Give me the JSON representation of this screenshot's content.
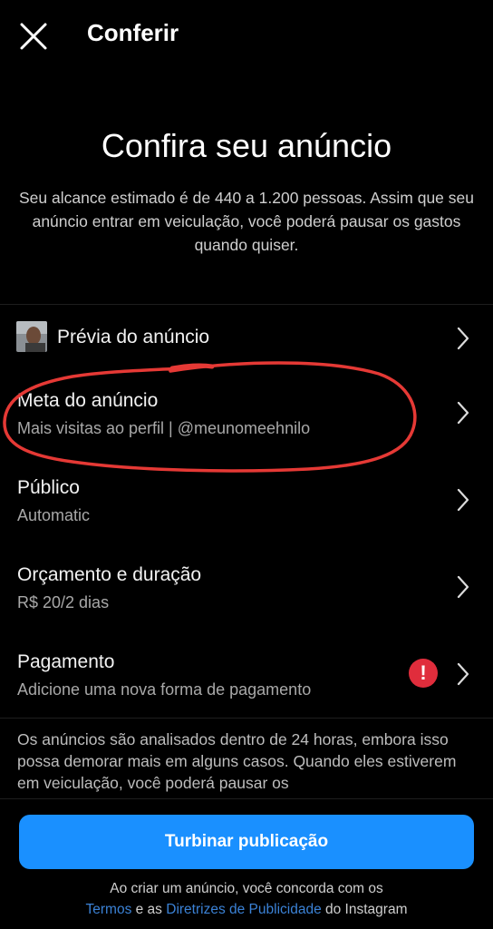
{
  "header": {
    "close_icon": "close-icon",
    "title": "Conferir"
  },
  "hero": {
    "title": "Confira seu anúncio",
    "subtitle": "Seu alcance estimado é de 440 a 1.200 pessoas. Assim que seu anúncio entrar em veiculação, você poderá pausar os gastos quando quiser."
  },
  "rows": {
    "preview": {
      "title": "Prévia do anúncio",
      "icon": "chevron-right-icon"
    },
    "goal": {
      "title": "Meta do anúncio",
      "subtitle": "Mais visitas ao perfil | @meunomeehnilo"
    },
    "audience": {
      "title": "Público",
      "subtitle": "Automatic"
    },
    "budget": {
      "title": "Orçamento e duração",
      "subtitle": "R$ 20/2 dias"
    },
    "payment": {
      "title": "Pagamento",
      "subtitle": "Adicione uma nova forma de pagamento",
      "alert_glyph": "!",
      "alert_color": "#e02d3c"
    }
  },
  "info": {
    "text": "Os anúncios são analisados dentro de 24 horas, embora isso possa demorar mais em alguns casos. Quando eles estiverem em veiculação, você poderá pausar os"
  },
  "cta": {
    "label": "Turbinar publicação",
    "color": "#1a90ff"
  },
  "terms": {
    "line1": "Ao criar um anúncio, você concorda com os",
    "terms_link": "Termos",
    "and_text": " e as ",
    "guidelines_link": "Diretrizes de Publicidade",
    "suffix": " do Instagram",
    "link_color": "#3b82d6"
  },
  "annotation_color": "#e53935"
}
